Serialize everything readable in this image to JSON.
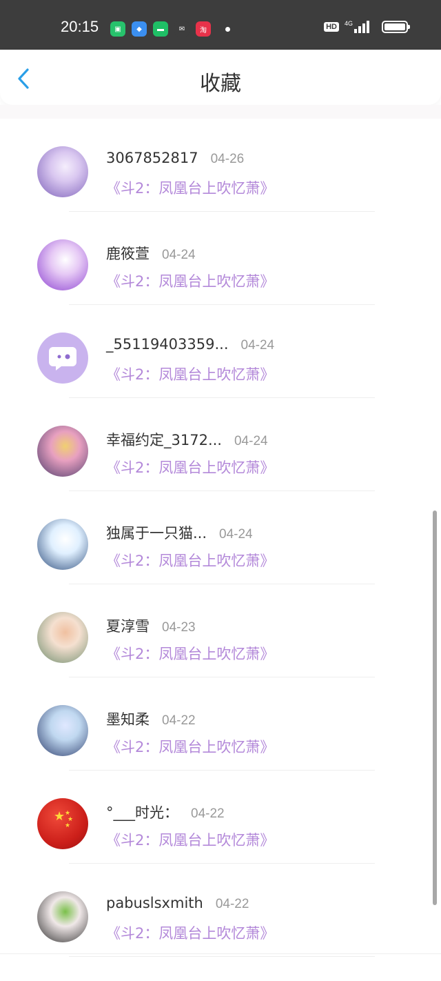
{
  "status_bar": {
    "time": "20:15",
    "hd_badge": "HD",
    "network": "4G",
    "app_icons": [
      {
        "name": "shopping-app-icon",
        "color": "#27c26c",
        "glyph": "▣"
      },
      {
        "name": "browser-app-icon",
        "color": "#3b8ff0",
        "glyph": "◆"
      },
      {
        "name": "messages-app-icon",
        "color": "#1fbf66",
        "glyph": "▬"
      },
      {
        "name": "wechat-app-icon",
        "color": "#3d3d3d",
        "glyph": "✉"
      },
      {
        "name": "taobao-app-icon",
        "color": "#e8324a",
        "glyph": "淘"
      }
    ]
  },
  "header": {
    "title": "收藏",
    "back_icon": "chevron-left-icon"
  },
  "colors": {
    "accent_blue": "#2a9fe8",
    "book_purple": "#b388d9",
    "default_avatar": "#c9b3ee"
  },
  "items": [
    {
      "name": "3067852817",
      "date": "04-26",
      "book": "《斗2：凤凰台上吹忆萧》",
      "avatar": {
        "type": "image",
        "c1": "#d9c7f0",
        "c2": "#7b5fb8",
        "c3": "#f5eefc"
      }
    },
    {
      "name": "鹿筱萱",
      "date": "04-24",
      "book": "《斗2：凤凰台上吹忆萧》",
      "avatar": {
        "type": "image",
        "c1": "#e6c9f5",
        "c2": "#8a3fd0",
        "c3": "#ffffff"
      }
    },
    {
      "name": "_55119403359...",
      "date": "04-24",
      "book": "《斗2：凤凰台上吹忆萧》",
      "avatar": {
        "type": "default"
      }
    },
    {
      "name": "幸福约定_3172...",
      "date": "04-24",
      "book": "《斗2：凤凰台上吹忆萧》",
      "avatar": {
        "type": "image",
        "c1": "#e8a0c0",
        "c2": "#4a3a6a",
        "c3": "#f0d070"
      }
    },
    {
      "name": "独属于一只猫...",
      "date": "04-24",
      "book": "《斗2：凤凰台上吹忆萧》",
      "avatar": {
        "type": "image",
        "c1": "#e0f0ff",
        "c2": "#2a4a7a",
        "c3": "#ffffff"
      }
    },
    {
      "name": "夏淳雪",
      "date": "04-23",
      "book": "《斗2：凤凰台上吹忆萧》",
      "avatar": {
        "type": "image",
        "c1": "#f5e0d0",
        "c2": "#6a8a6a",
        "c3": "#f0c0a0"
      }
    },
    {
      "name": "墨知柔",
      "date": "04-22",
      "book": "《斗2：凤凰台上吹忆萧》",
      "avatar": {
        "type": "image",
        "c1": "#c0d8f0",
        "c2": "#2a3a6a",
        "c3": "#e0e8ff"
      }
    },
    {
      "name": "°___时光：",
      "date": "04-22",
      "book": "《斗2：凤凰台上吹忆萧》",
      "avatar": {
        "type": "flag"
      }
    },
    {
      "name": "pabuslsxmith",
      "date": "04-22",
      "book": "《斗2：凤凰台上吹忆萧》",
      "avatar": {
        "type": "image",
        "c1": "#f0e8e8",
        "c2": "#2a2a2a",
        "c3": "#7ac04a"
      }
    }
  ]
}
